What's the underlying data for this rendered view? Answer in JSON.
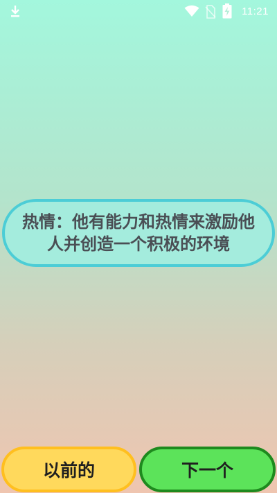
{
  "status_bar": {
    "time": "11:21",
    "icons": [
      "download-icon",
      "wifi-icon",
      "no-sim-icon",
      "battery-charging-icon"
    ]
  },
  "quote": {
    "text": "热情：他有能力和热情来激励他人并创造一个积极的环境"
  },
  "buttons": {
    "prev_label": "以前的",
    "next_label": "下一个"
  },
  "colors": {
    "bubble_border": "#4ccdd6",
    "bubble_fill": "#a4ecdd",
    "prev_fill": "#ffd95c",
    "prev_border": "#ffbf1f",
    "next_fill": "#5ce35a",
    "next_border": "#1e8a1e"
  }
}
